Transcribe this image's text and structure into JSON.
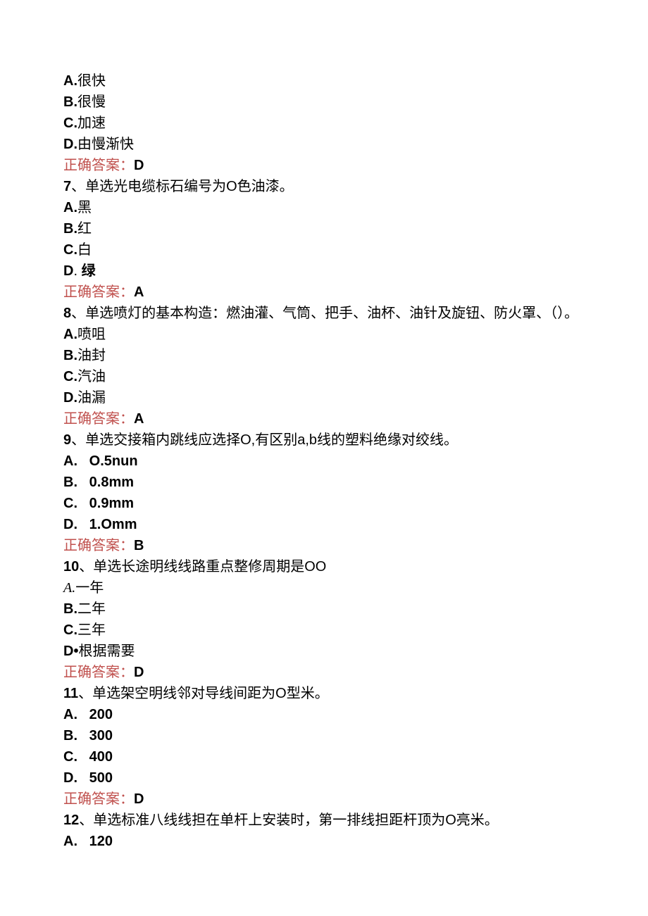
{
  "lines": [
    {
      "type": "opt",
      "letter": "A.",
      "text": "很快"
    },
    {
      "type": "opt",
      "letter": "B.",
      "text": "很慢"
    },
    {
      "type": "opt",
      "letter": "C.",
      "text": "加速"
    },
    {
      "type": "opt",
      "letter": "D.",
      "text": "由慢渐快"
    },
    {
      "type": "ans",
      "label": "正确答案：",
      "value": "D"
    },
    {
      "type": "q",
      "num": "7",
      "text": "、单选光电缆标石编号为O色油漆。"
    },
    {
      "type": "opt",
      "letter": "A.",
      "text": "黑"
    },
    {
      "type": "opt",
      "letter": "B.",
      "text": "红"
    },
    {
      "type": "opt",
      "letter": "C.",
      "text": "白"
    },
    {
      "type": "opt_spaced",
      "letter": "D",
      "sep": ". ",
      "text": "绿"
    },
    {
      "type": "ans",
      "label": "正确答案：",
      "value": "A"
    },
    {
      "type": "q",
      "num": "8",
      "text": "、单选喷灯的基本构造：燃油灌、气筒、把手、油杯、油针及旋钮、防火罩、（）。"
    },
    {
      "type": "opt",
      "letter": "A.",
      "text": "喷咀"
    },
    {
      "type": "opt",
      "letter": "B.",
      "text": "油封"
    },
    {
      "type": "opt",
      "letter": "C.",
      "text": "汽油"
    },
    {
      "type": "opt",
      "letter": "D.",
      "text": "油漏"
    },
    {
      "type": "ans",
      "label": "正确答案：",
      "value": "A"
    },
    {
      "type": "q",
      "num": "9",
      "text": "、单选交接箱内跳线应选择O,有区别a,b线的塑料绝缘对绞线。"
    },
    {
      "type": "opt_spaced",
      "letter": "A.",
      "sep": "   ",
      "text": "O.5nun"
    },
    {
      "type": "opt_spaced",
      "letter": "B.",
      "sep": "   ",
      "text": "0.8mm"
    },
    {
      "type": "opt_spaced",
      "letter": "C.",
      "sep": "   ",
      "text": "0.9mm"
    },
    {
      "type": "opt_spaced",
      "letter": "D.",
      "sep": "   ",
      "text": "1.Omm"
    },
    {
      "type": "ans",
      "label": "正确答案：",
      "value": "B"
    },
    {
      "type": "q",
      "num": "10",
      "text": "、单选长途明线线路重点整修周期是OO"
    },
    {
      "type": "opt_italic",
      "letter": "A.",
      "text": "一年"
    },
    {
      "type": "opt",
      "letter": "B.",
      "text": "二年"
    },
    {
      "type": "opt",
      "letter": "C.",
      "text": "三年"
    },
    {
      "type": "opt",
      "letter": "D•",
      "text": "根据需要"
    },
    {
      "type": "ans",
      "label": "正确答案：",
      "value": "D"
    },
    {
      "type": "q",
      "num": "11",
      "text": "、单选架空明线邻对导线间距为O型米。"
    },
    {
      "type": "opt_spaced",
      "letter": "A.",
      "sep": "   ",
      "text": "200"
    },
    {
      "type": "opt_spaced",
      "letter": "B.",
      "sep": "   ",
      "text": "300"
    },
    {
      "type": "opt_spaced",
      "letter": "C.",
      "sep": "   ",
      "text": "400"
    },
    {
      "type": "opt_spaced",
      "letter": "D.",
      "sep": "   ",
      "text": "500"
    },
    {
      "type": "ans",
      "label": "正确答案：",
      "value": "D"
    },
    {
      "type": "q",
      "num": "12",
      "text": "、单选标准八线线担在单杆上安装时，第一排线担距杆顶为O亮米。"
    },
    {
      "type": "opt_spaced",
      "letter": "A.",
      "sep": "   ",
      "text": "120"
    }
  ]
}
